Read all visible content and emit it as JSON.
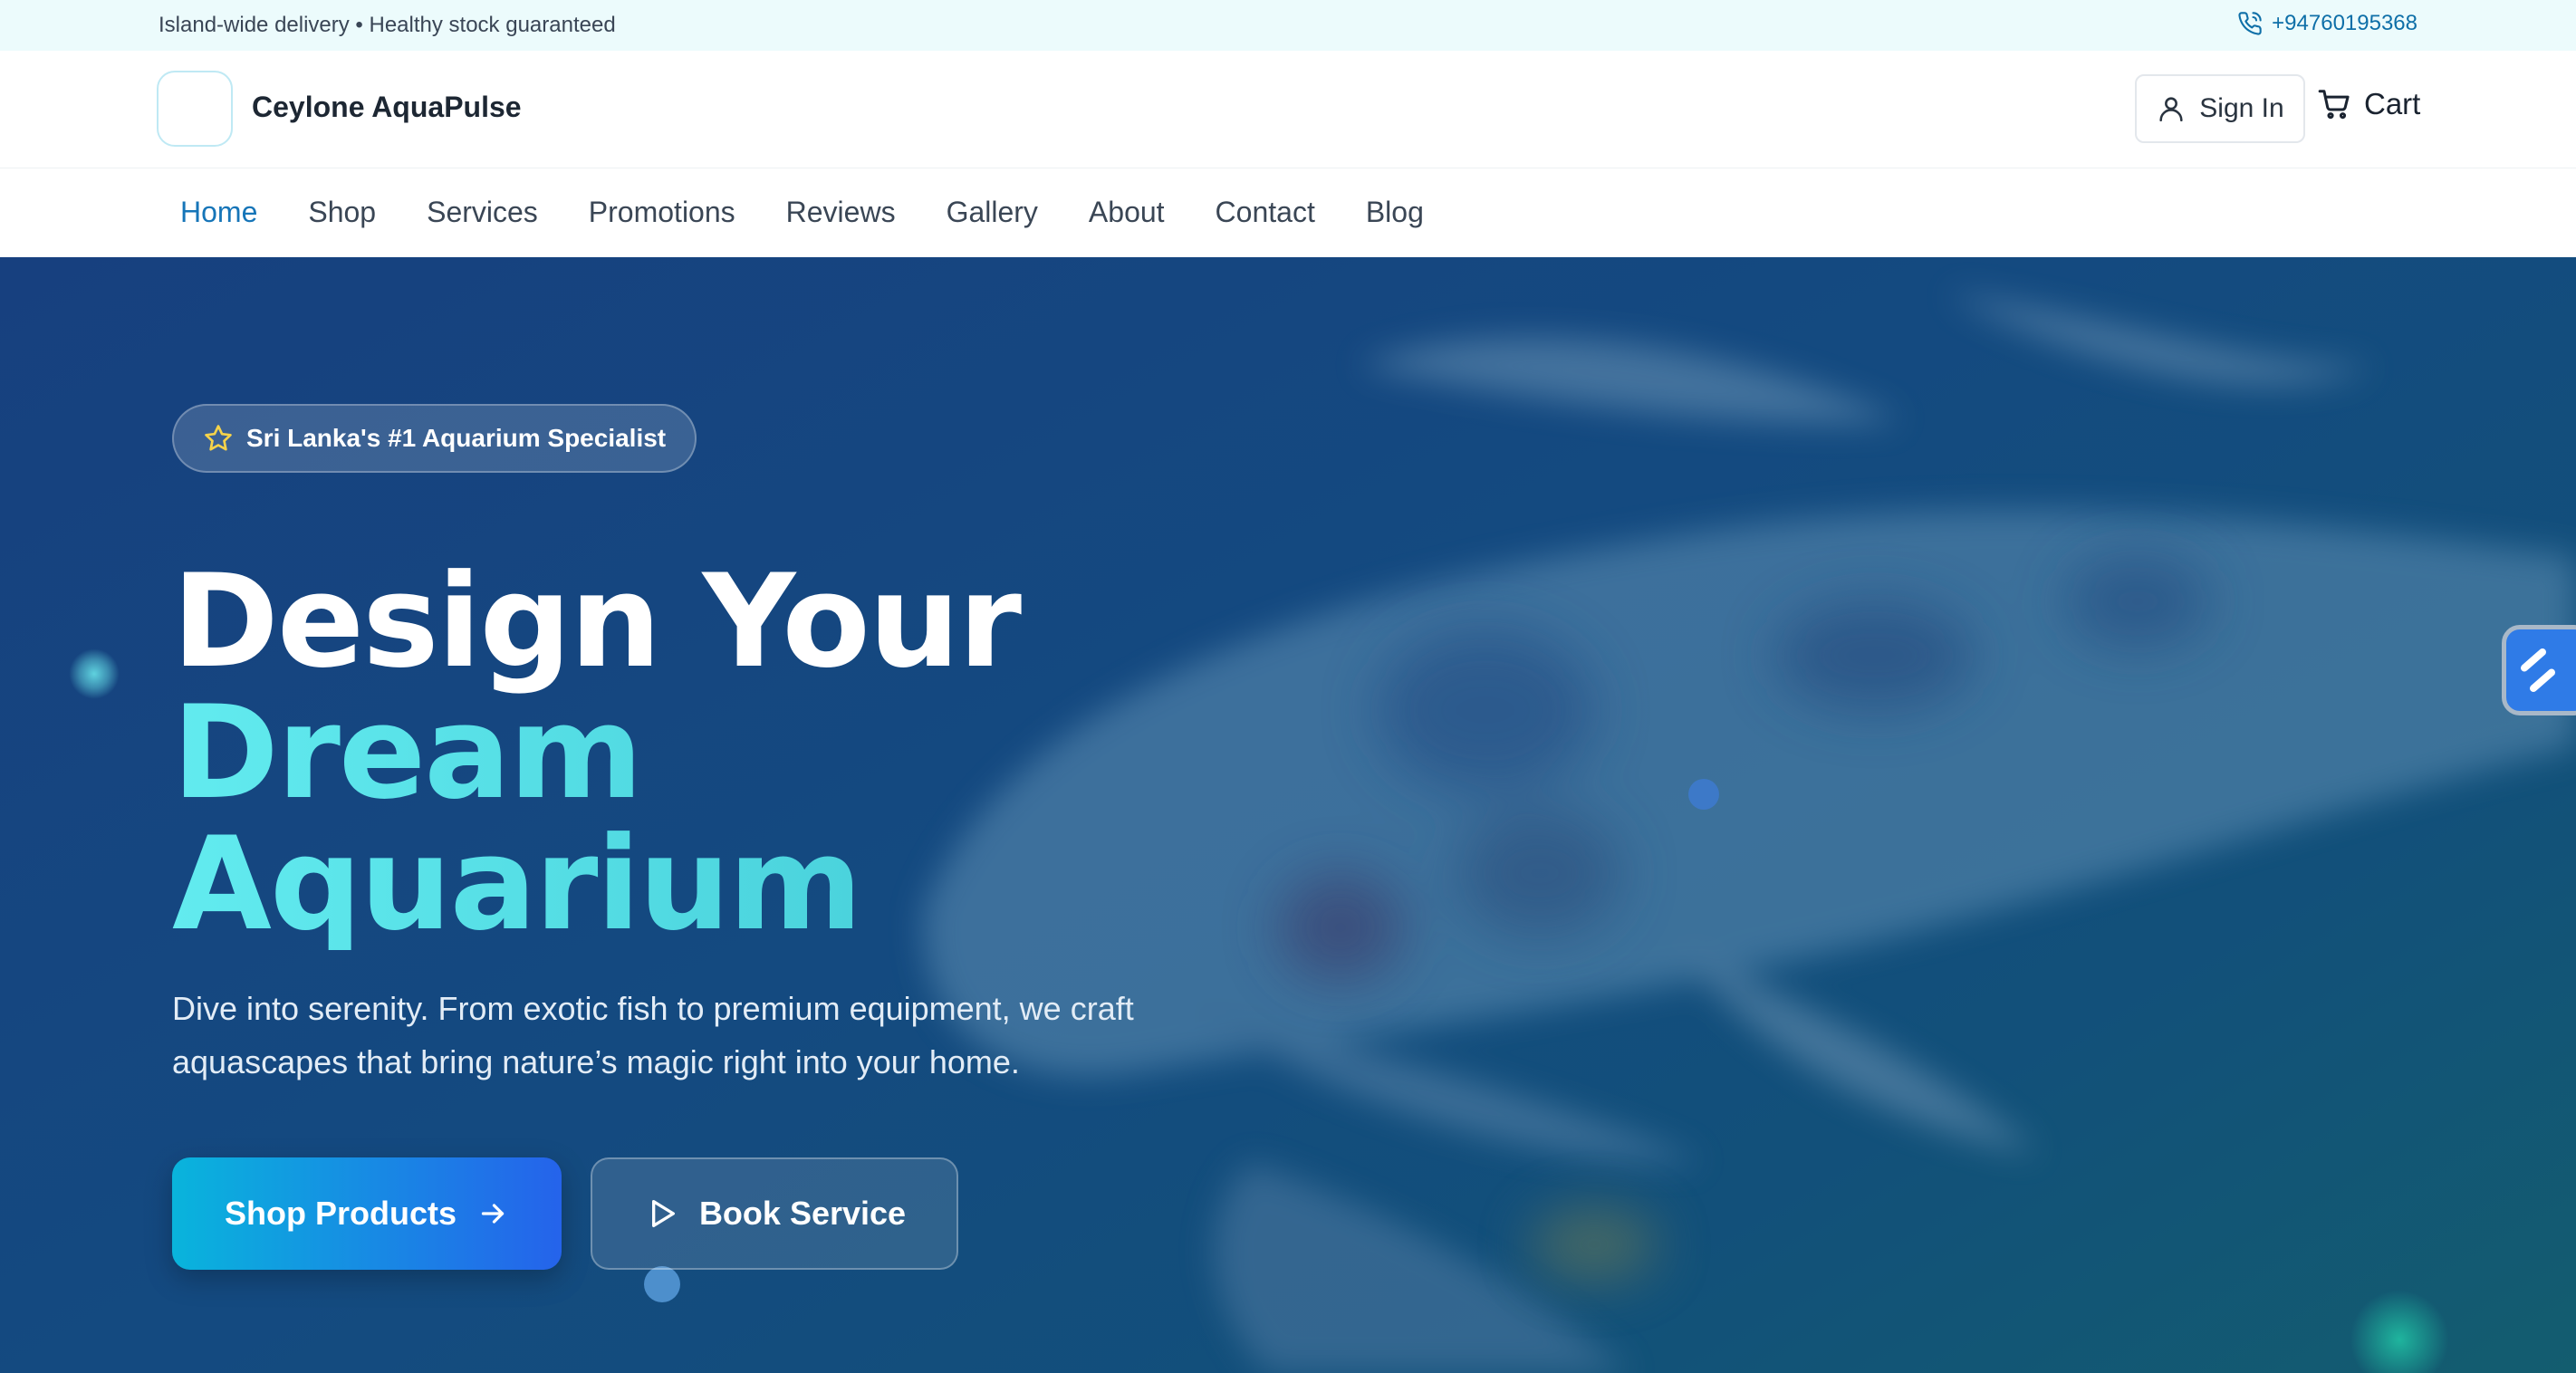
{
  "topbar": {
    "message": "Island-wide delivery • Healthy stock guaranteed",
    "phone": "+94760195368",
    "phone_icon": "phone-icon"
  },
  "header": {
    "brand": "Ceylone AquaPulse",
    "signin_label": "Sign In",
    "cart_label": "Cart",
    "icons": [
      "user-icon",
      "cart-icon"
    ]
  },
  "nav": {
    "items": [
      {
        "label": "Home",
        "active": true
      },
      {
        "label": "Shop"
      },
      {
        "label": "Services"
      },
      {
        "label": "Promotions"
      },
      {
        "label": "Reviews"
      },
      {
        "label": "Gallery"
      },
      {
        "label": "About"
      },
      {
        "label": "Contact"
      },
      {
        "label": "Blog"
      }
    ]
  },
  "hero": {
    "badge": "Sri Lanka's #1 Aquarium Specialist",
    "headline": {
      "line1": "Design Your",
      "line2": "Dream",
      "line3": "Aquarium"
    },
    "subtitle": "Dive into serenity. From exotic fish to premium equipment, we craft aquascapes that bring nature’s magic right into your home.",
    "primary_cta": "Shop Products",
    "secondary_cta": "Book Service"
  },
  "colors": {
    "accent": "#1675b8",
    "headline_highlight": "#5fe0e6",
    "cta_gradient_start": "#09b4dc",
    "cta_gradient_end": "#2563eb",
    "hero_background": "#144a80"
  }
}
